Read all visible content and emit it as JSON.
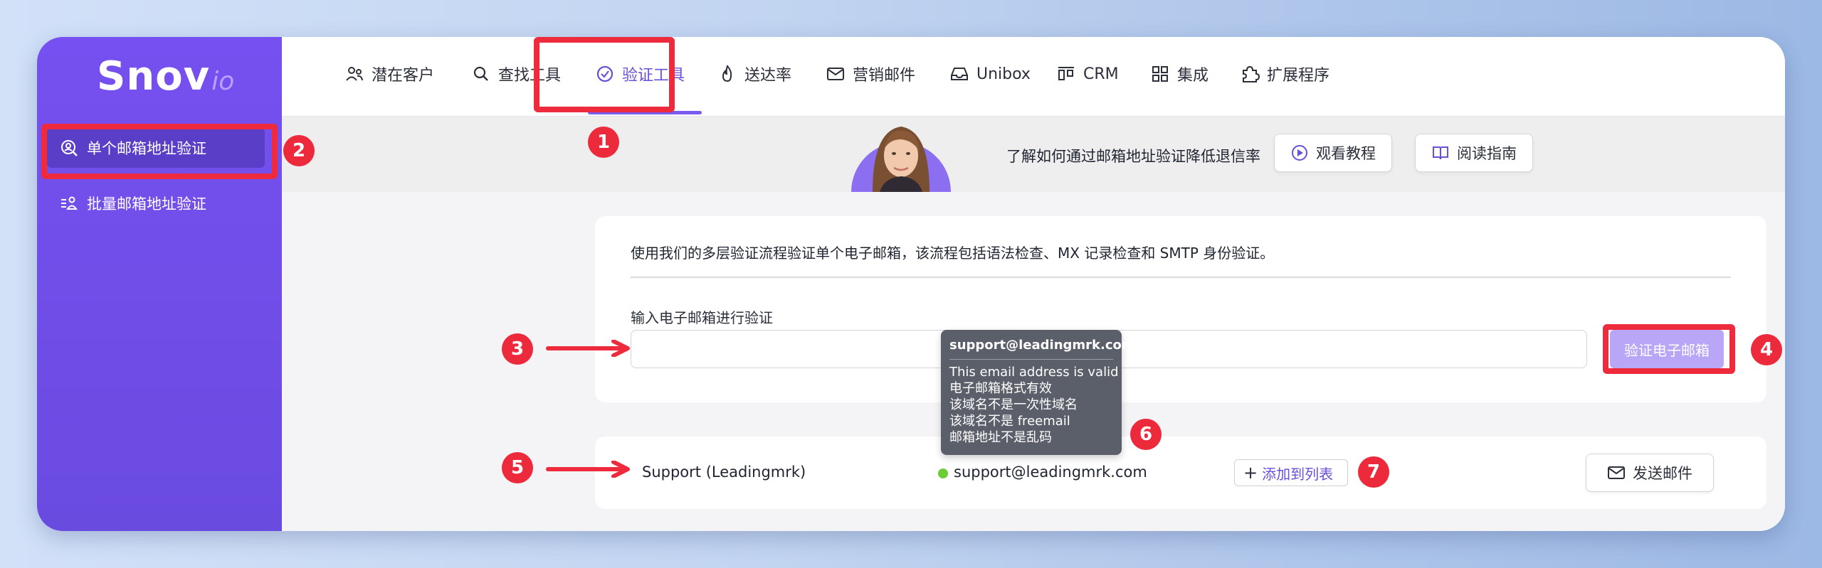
{
  "brand": {
    "name": "Snov",
    "suffix": "io"
  },
  "sidebar": {
    "items": [
      {
        "label": "单个邮箱地址验证",
        "icon": "search-user-icon",
        "active": true
      },
      {
        "label": "批量邮箱地址验证",
        "icon": "list-user-icon",
        "active": false
      }
    ]
  },
  "nav": {
    "items": [
      {
        "label": "潜在客户",
        "icon": "users-icon"
      },
      {
        "label": "查找工具",
        "icon": "search-icon"
      },
      {
        "label": "验证工具",
        "icon": "check-circle-icon",
        "active": true
      },
      {
        "label": "送达率",
        "icon": "flame-icon"
      },
      {
        "label": "营销邮件",
        "icon": "mail-icon"
      },
      {
        "label": "Unibox",
        "icon": "inbox-icon"
      },
      {
        "label": "CRM",
        "icon": "crm-icon"
      },
      {
        "label": "集成",
        "icon": "grid-icon"
      },
      {
        "label": "扩展程序",
        "icon": "puzzle-icon"
      }
    ]
  },
  "banner": {
    "text": "了解如何通过邮箱地址验证降低退信率",
    "watch_label": "观看教程",
    "read_label": "阅读指南"
  },
  "verify": {
    "description": "使用我们的多层验证流程验证单个电子邮箱，该流程包括语法检查、MX 记录检查和 SMTP 身份验证。",
    "input_label": "输入电子邮箱进行验证",
    "input_value": "",
    "button_label": "验证电子邮箱"
  },
  "tooltip": {
    "title": "support@leadingmrk.com",
    "lines": [
      "This email address is valid",
      "电子邮箱格式有效",
      "该域名不是一次性域名",
      "该域名不是 freemail",
      "邮箱地址不是乱码"
    ]
  },
  "result": {
    "name": "Support (Leadingmrk)",
    "email": "support@leadingmrk.com",
    "add_label": "添加到列表",
    "send_label": "发送邮件"
  },
  "annotations": [
    "1",
    "2",
    "3",
    "4",
    "5",
    "6",
    "7"
  ],
  "colors": {
    "accent": "#6b4fd8",
    "sidebar": "#7650f0",
    "highlight": "#ee2b3d",
    "valid": "#6ccd36",
    "verify_button": "#b9a6f6"
  }
}
